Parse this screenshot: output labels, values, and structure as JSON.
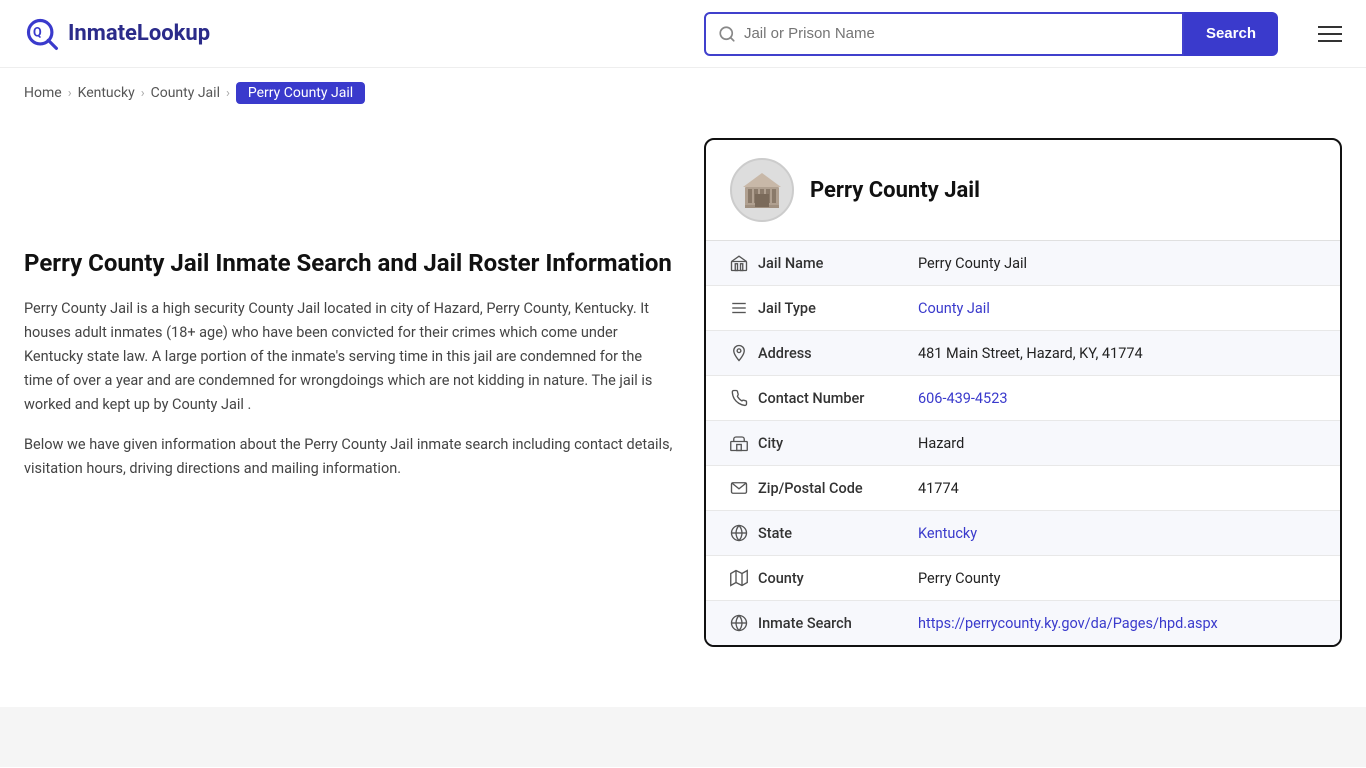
{
  "header": {
    "logo_text": "InmateLookup",
    "search_placeholder": "Jail or Prison Name",
    "search_button_label": "Search"
  },
  "breadcrumb": {
    "home": "Home",
    "kentucky": "Kentucky",
    "county_jail": "County Jail",
    "current": "Perry County Jail"
  },
  "left": {
    "heading": "Perry County Jail Inmate Search and Jail Roster Information",
    "paragraph1": "Perry County Jail is a high security County Jail located in city of Hazard, Perry County, Kentucky. It houses adult inmates (18+ age) who have been convicted for their crimes which come under Kentucky state law. A large portion of the inmate's serving time in this jail are condemned for the time of over a year and are condemned for wrongdoings which are not kidding in nature. The jail is worked and kept up by County Jail .",
    "paragraph2": "Below we have given information about the Perry County Jail inmate search including contact details, visitation hours, driving directions and mailing information."
  },
  "card": {
    "title": "Perry County Jail",
    "rows": [
      {
        "icon": "🏛",
        "label": "Jail Name",
        "value": "Perry County Jail",
        "link": null
      },
      {
        "icon": "☰",
        "label": "Jail Type",
        "value": "County Jail",
        "link": "#"
      },
      {
        "icon": "📍",
        "label": "Address",
        "value": "481 Main Street, Hazard, KY, 41774",
        "link": null
      },
      {
        "icon": "📞",
        "label": "Contact Number",
        "value": "606-439-4523",
        "link": "tel:606-439-4523"
      },
      {
        "icon": "🏙",
        "label": "City",
        "value": "Hazard",
        "link": null
      },
      {
        "icon": "✉",
        "label": "Zip/Postal Code",
        "value": "41774",
        "link": null
      },
      {
        "icon": "🌐",
        "label": "State",
        "value": "Kentucky",
        "link": "#"
      },
      {
        "icon": "🗺",
        "label": "County",
        "value": "Perry County",
        "link": null
      },
      {
        "icon": "🌐",
        "label": "Inmate Search",
        "value": "https://perrycounty.ky.gov/da/Pages/hpd.aspx",
        "link": "https://perrycounty.ky.gov/da/Pages/hpd.aspx"
      }
    ]
  }
}
